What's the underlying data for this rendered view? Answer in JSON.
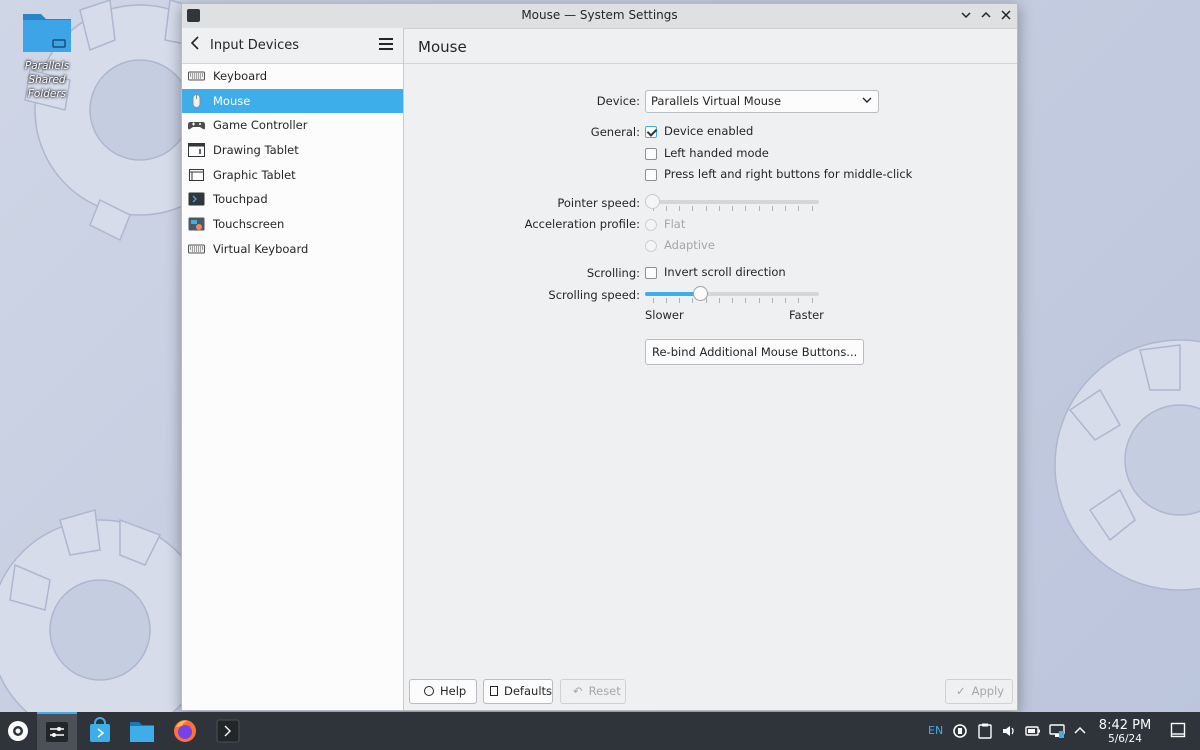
{
  "desktop": {
    "shared_folder_label_line1": "Parallels Shared",
    "shared_folder_label_line2": "Folders"
  },
  "window": {
    "title": "Mouse — System Settings"
  },
  "sidebar": {
    "back_title": "Input Devices",
    "items": [
      {
        "label": "Keyboard",
        "icon": "keyboard-icon",
        "active": false
      },
      {
        "label": "Mouse",
        "icon": "mouse-icon",
        "active": true
      },
      {
        "label": "Game Controller",
        "icon": "gamepad-icon",
        "active": false
      },
      {
        "label": "Drawing Tablet",
        "icon": "drawing-tablet-icon",
        "active": false
      },
      {
        "label": "Graphic Tablet",
        "icon": "graphic-tablet-icon",
        "active": false
      },
      {
        "label": "Touchpad",
        "icon": "touchpad-icon",
        "active": false
      },
      {
        "label": "Touchscreen",
        "icon": "touchscreen-icon",
        "active": false
      },
      {
        "label": "Virtual Keyboard",
        "icon": "virtual-keyboard-icon",
        "active": false
      }
    ]
  },
  "main": {
    "page_title": "Mouse",
    "device_label": "Device:",
    "device_value": "Parallels Virtual Mouse",
    "general_label": "General:",
    "device_enabled": "Device enabled",
    "left_handed": "Left handed mode",
    "middle_click": "Press left and right buttons for middle-click",
    "pointer_speed_label": "Pointer speed:",
    "pointer_speed_fraction": 0.0,
    "accel_label": "Acceleration profile:",
    "accel_flat": "Flat",
    "accel_adaptive": "Adaptive",
    "scrolling_label": "Scrolling:",
    "invert_scroll": "Invert scroll direction",
    "scroll_speed_label": "Scrolling speed:",
    "scroll_speed_fraction": 0.3,
    "slower": "Slower",
    "faster": "Faster",
    "rebind_button": "Re-bind Additional Mouse Buttons..."
  },
  "footer": {
    "help": "Help",
    "defaults": "Defaults",
    "reset": "Reset",
    "apply": "Apply"
  },
  "taskbar": {
    "lang": "EN",
    "time": "8:42 PM",
    "date": "5/6/24"
  },
  "colors": {
    "accent": "#3daee9",
    "taskbar": "#2f343a"
  }
}
